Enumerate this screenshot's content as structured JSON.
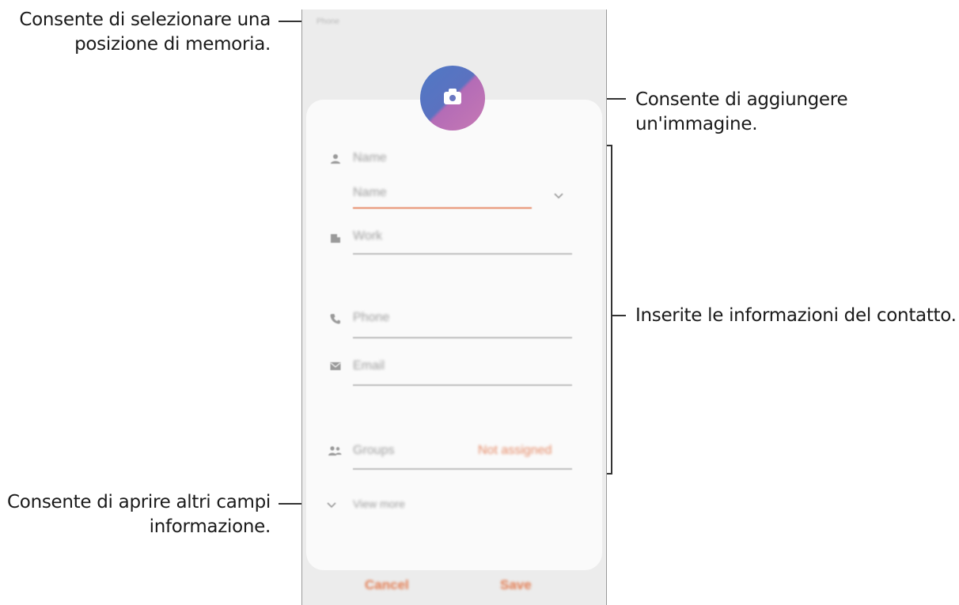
{
  "annotations": {
    "storage": [
      "Consente di selezionare una",
      "posizione di memoria."
    ],
    "image": [
      "Consente di aggiungere",
      "un'immagine."
    ],
    "contact_info": [
      "Inserite le informazioni del contatto."
    ],
    "more_fields": [
      "Consente di aprire altri campi",
      "informazione."
    ]
  },
  "phone": {
    "storage_label": "Phone",
    "fields": {
      "name_header": "Name",
      "name_input": "Name",
      "work": "Work",
      "phone": "Phone",
      "email": "Email",
      "groups": "Groups",
      "groups_value": "Not assigned",
      "view_more": "View more"
    },
    "buttons": {
      "cancel": "Cancel",
      "save": "Save"
    },
    "colors": {
      "accent": "#e27a4f",
      "underline_active": "#e58864",
      "avatar_blue": "#4f78c5",
      "avatar_pink": "#c679b4"
    },
    "icons": [
      "person-icon",
      "chevron-down-icon",
      "building-icon",
      "phone-icon",
      "email-icon",
      "group-icon",
      "camera-icon"
    ]
  }
}
